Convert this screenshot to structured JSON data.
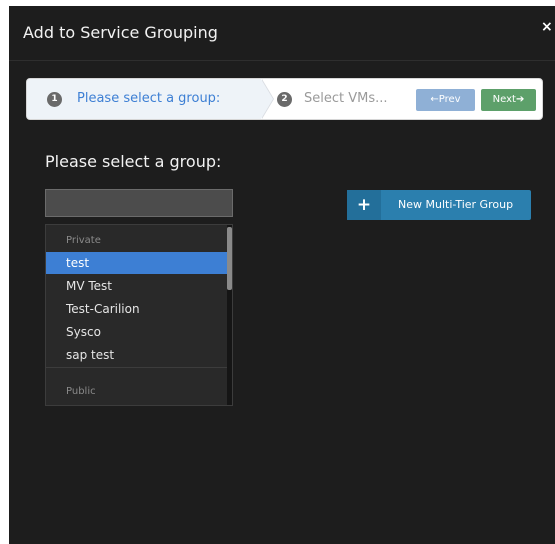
{
  "dialog": {
    "title": "Add to Service Grouping",
    "close_label": "×"
  },
  "wizard": {
    "steps": [
      {
        "number": "1",
        "label": "Please select a group:",
        "active": true
      },
      {
        "number": "2",
        "label": "Select VMs...",
        "active": false
      }
    ],
    "prev_label": "←Prev",
    "next_label": "Next➔"
  },
  "main": {
    "heading": "Please select a group:",
    "new_group_button": {
      "icon": "+",
      "label": "New Multi-Tier Group"
    },
    "group_list": {
      "groups": [
        {
          "label": "Private"
        },
        {
          "label": "Public"
        }
      ],
      "options": [
        {
          "label": "test",
          "selected": true
        },
        {
          "label": "MV Test",
          "selected": false
        },
        {
          "label": "Test-Carilion",
          "selected": false
        },
        {
          "label": "Sysco",
          "selected": false
        },
        {
          "label": "sap test",
          "selected": false
        }
      ]
    }
  },
  "colors": {
    "dialog_bg": "#1d1d1d",
    "selected_option": "#3d7fd4",
    "prev_button": "#8fb0d6",
    "next_button": "#5da06a",
    "new_group_button": "#2b7fae"
  }
}
